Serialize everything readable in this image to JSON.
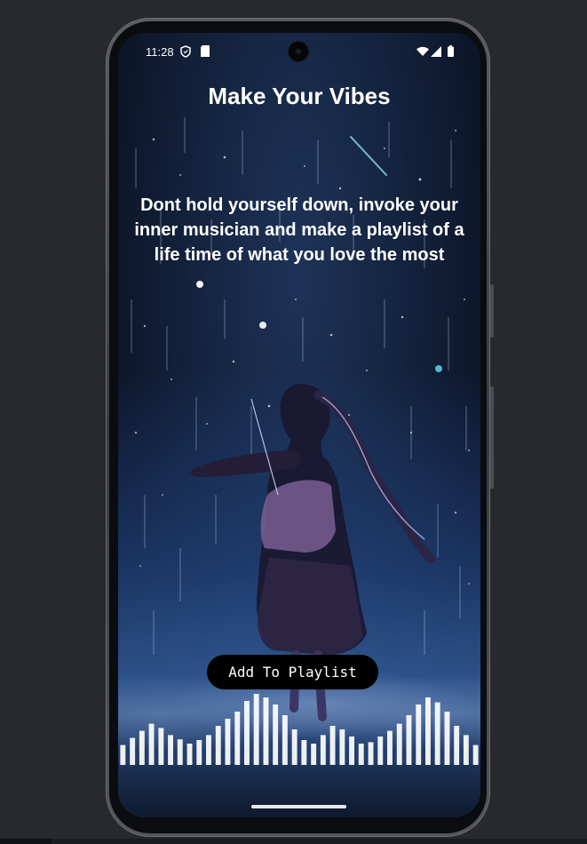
{
  "status_bar": {
    "time": "11:28",
    "icons": [
      "shield-icon",
      "sim-card-icon",
      "wifi-icon",
      "signal-icon",
      "battery-icon"
    ]
  },
  "screen": {
    "title": "Make Your Vibes",
    "subtitle": "Dont hold yourself down, invoke your inner musician and make a playlist of a life time of what you love the most",
    "button_label": "Add To Playlist"
  },
  "background": {
    "image_description_icon": "anime-violinist-night-sky-image"
  },
  "equalizer": {
    "levels": [
      0.28,
      0.38,
      0.48,
      0.58,
      0.52,
      0.42,
      0.36,
      0.3,
      0.35,
      0.42,
      0.55,
      0.65,
      0.75,
      0.9,
      1.0,
      0.95,
      0.85,
      0.7,
      0.5,
      0.35,
      0.3,
      0.42,
      0.55,
      0.5,
      0.4,
      0.3,
      0.32,
      0.4,
      0.48,
      0.58,
      0.7,
      0.85,
      0.95,
      0.88,
      0.75,
      0.55,
      0.42,
      0.28
    ],
    "color": "#ffffff"
  },
  "colors": {
    "background": "#28292d",
    "button": "#000000",
    "text": "#ffffff"
  }
}
